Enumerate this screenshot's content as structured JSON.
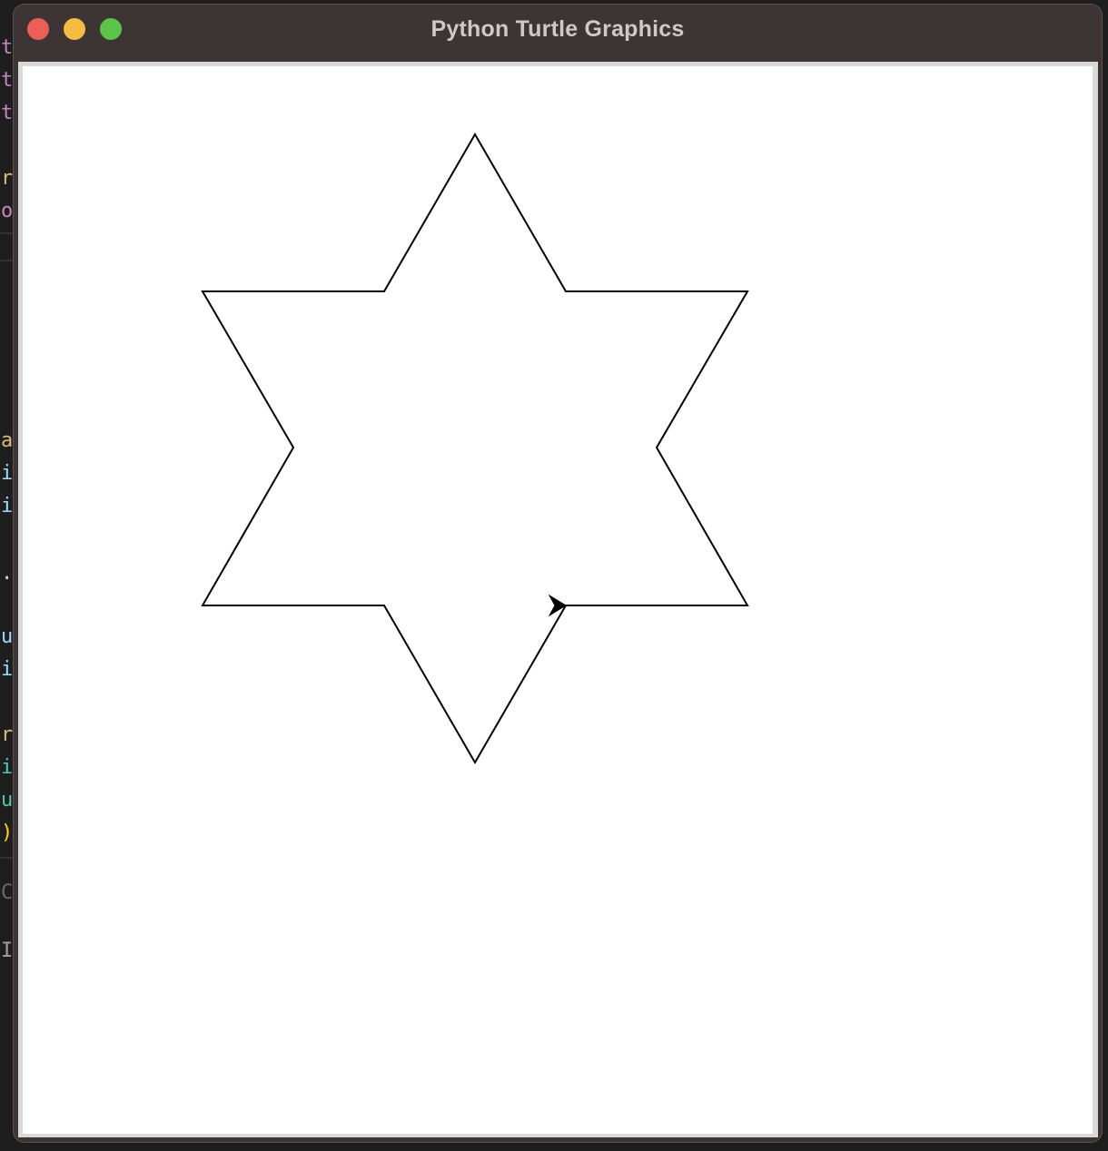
{
  "window": {
    "title": "Python Turtle Graphics",
    "controls": [
      "close",
      "minimize",
      "maximize"
    ]
  },
  "background_editor": {
    "visible_chars": [
      {
        "text": "t",
        "color": "#c586c0"
      },
      {
        "text": "t",
        "color": "#c586c0"
      },
      {
        "text": "t",
        "color": "#c586c0"
      },
      {
        "text": "r",
        "color": "#d7ba7d"
      },
      {
        "text": "o",
        "color": "#c586c0"
      },
      {
        "text": "a",
        "color": "#d7ba7d"
      },
      {
        "text": "i",
        "color": "#9cdcfe"
      },
      {
        "text": "i",
        "color": "#9cdcfe"
      },
      {
        "text": ".",
        "color": "#d4d4d4"
      },
      {
        "text": "u",
        "color": "#9cdcfe"
      },
      {
        "text": "i",
        "color": "#9cdcfe"
      },
      {
        "text": "r",
        "color": "#d7ba7d"
      },
      {
        "text": "i",
        "color": "#4ec9b0"
      },
      {
        "text": "u",
        "color": "#4ec9b0"
      },
      {
        "text": ")",
        "color": "#ffd700"
      },
      {
        "text": "C",
        "color": "#6a6a6a"
      },
      {
        "text": "Ib",
        "color": "#a0a0a0"
      }
    ]
  },
  "turtle_canvas": {
    "shape": "hexagram",
    "stroke_color": "#000000",
    "background": "#ffffff",
    "cursor": "turtle-arrow"
  }
}
